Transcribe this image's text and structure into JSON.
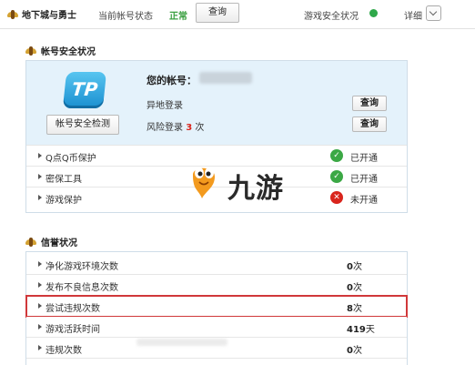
{
  "topbar": {
    "game_name": "地下城与勇士",
    "account_status_label": "当前帐号状态",
    "account_status_value": "正常",
    "query_button": "查询",
    "game_safety_label": "游戏安全状况",
    "detail_label": "详细",
    "status_color": "#2fa84a"
  },
  "account_security": {
    "title": "帐号安全状况",
    "logo_text": "TP",
    "check_button": "帐号安全检测",
    "account_label": "您的帐号：",
    "remote_login_label": "异地登录",
    "remote_login_button": "查询",
    "risk_login_prefix": "风险登录",
    "risk_login_count": "3",
    "risk_login_suffix": "次",
    "risk_login_button": "查询",
    "protections": [
      {
        "label": "Q点Q币保护",
        "status": "已开通",
        "icon": "check-icon",
        "color": "#3ba845"
      },
      {
        "label": "密保工具",
        "status": "已开通",
        "icon": "check-icon",
        "color": "#3ba845"
      },
      {
        "label": "游戏保护",
        "status": "未开通",
        "icon": "cross-icon",
        "color": "#d9251d"
      }
    ]
  },
  "watermark": {
    "text": "九游"
  },
  "credit": {
    "title": "信誉状况",
    "rows": [
      {
        "label": "净化游戏环境次数",
        "value": "0",
        "unit": "次"
      },
      {
        "label": "发布不良信息次数",
        "value": "0",
        "unit": "次"
      },
      {
        "label": "尝试违规次数",
        "value": "8",
        "unit": "次",
        "highlighted": true
      },
      {
        "label": "游戏活跃时间",
        "value": "419",
        "unit": "天"
      },
      {
        "label": "违规次数",
        "value": "0",
        "unit": "次"
      }
    ],
    "highlight_color": "#d0383a"
  }
}
